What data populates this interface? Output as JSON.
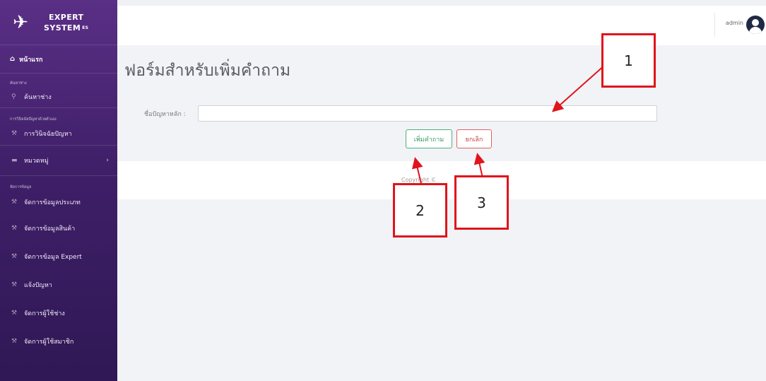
{
  "brand": {
    "line1": "EXPERT",
    "line2": "SYSTEM",
    "suffix": "ES"
  },
  "sidebar": {
    "home": "หน้าแรก",
    "section_search": "ค้นหาช่าง",
    "search_item": "ค้นหาช่าง",
    "section_diagnose": "การวินิจฉัยปัญหาด้วยตัวเอง",
    "diagnose_item": "การวินิจฉัยปัญหา",
    "category_item": "หมวดหมู่",
    "section_data": "จัดการข้อมูล",
    "items": [
      "จัดการข้อมูลประเภท",
      "จัดการข้อมูลสินค้า",
      "จัดการข้อมูล Expert",
      "แจ้งปัญหา",
      "จัดการผู้ใช้ช่าง",
      "จัดการผู้ใช้สมาชิก"
    ]
  },
  "topbar": {
    "user": "admin"
  },
  "form": {
    "title": "ฟอร์มสำหรับเพิ่มคำถาม",
    "label": "ชื่อปัญหาหลัก :",
    "value": "",
    "add_button": "เพิ่มคำถาม",
    "cancel_button": "ยกเลิก"
  },
  "footer": {
    "text": "Copyright © Your"
  },
  "annotations": [
    "1",
    "2",
    "3"
  ],
  "colors": {
    "sidebar": "#4a2575",
    "annotation": "#e0141c",
    "add": "#4caf7d",
    "cancel": "#e06060"
  }
}
